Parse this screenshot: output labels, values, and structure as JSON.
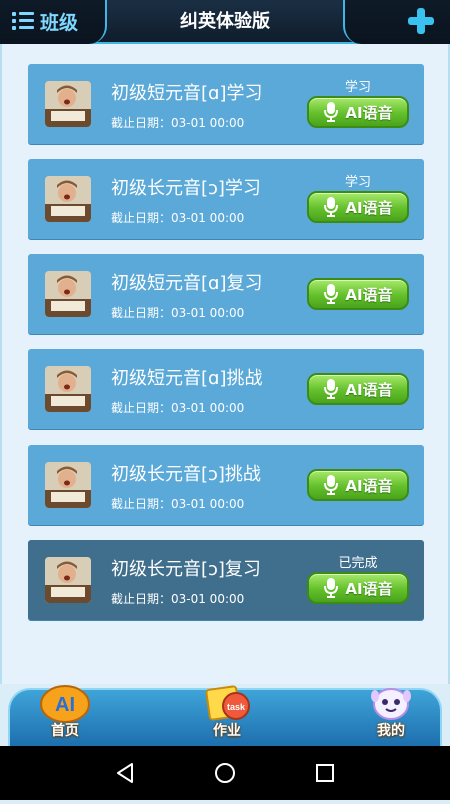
{
  "header": {
    "title": "纠英体验版",
    "class_label": "班级"
  },
  "tasks": [
    {
      "title": "初级短元音[ɑ]学习",
      "date": "截止日期：03-01 00:00",
      "status": "学习",
      "button": "AI语音"
    },
    {
      "title": "初级长元音[ɔ]学习",
      "date": "截止日期：03-01 00:00",
      "status": "学习",
      "button": "AI语音"
    },
    {
      "title": "初级短元音[ɑ]复习",
      "date": "截止日期：03-01 00:00",
      "status": "",
      "button": "AI语音"
    },
    {
      "title": "初级短元音[ɑ]挑战",
      "date": "截止日期：03-01 00:00",
      "status": "",
      "button": "AI语音"
    },
    {
      "title": "初级长元音[ɔ]挑战",
      "date": "截止日期：03-01 00:00",
      "status": "",
      "button": "AI语音"
    },
    {
      "title": "初级长元音[ɔ]复习",
      "date": "截止日期：03-01 00:00",
      "status": "已完成",
      "button": "AI语音"
    }
  ],
  "tabs": [
    {
      "label": "首页",
      "badge": "AI"
    },
    {
      "label": "作业",
      "badge": "task"
    },
    {
      "label": "我的",
      "badge": ""
    }
  ],
  "icons": {
    "menu": "list-icon",
    "add": "plus-icon",
    "mic": "microphone-icon",
    "back": "back-icon",
    "home": "home-icon",
    "recents": "recents-icon"
  },
  "colors": {
    "card": "#5aa9d8",
    "card_done": "#3f6f8c",
    "button_green": "#63c02b",
    "header_accent": "#3fb6e6"
  }
}
